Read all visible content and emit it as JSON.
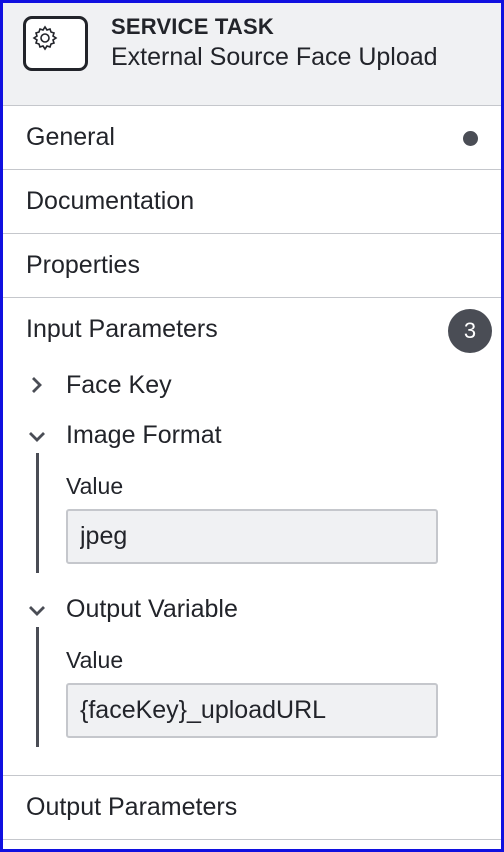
{
  "header": {
    "type": "SERVICE TASK",
    "name": "External Source Face Upload",
    "icon": "gear-icon"
  },
  "groups": {
    "general": {
      "label": "General"
    },
    "documentation": {
      "label": "Documentation"
    },
    "properties": {
      "label": "Properties"
    },
    "input_parameters": {
      "label": "Input Parameters",
      "count": "3",
      "items": [
        {
          "label": "Face Key",
          "expanded": false
        },
        {
          "label": "Image Format",
          "expanded": true,
          "field_label": "Value",
          "value": "jpeg"
        },
        {
          "label": "Output Variable",
          "expanded": true,
          "field_label": "Value",
          "value": "{faceKey}_uploadURL"
        }
      ]
    },
    "output_parameters": {
      "label": "Output Parameters"
    }
  },
  "colors": {
    "frame": "#1010e0",
    "header_bg": "#f0f1f3",
    "badge": "#4a4d55",
    "divider": "#c5c7cc"
  }
}
